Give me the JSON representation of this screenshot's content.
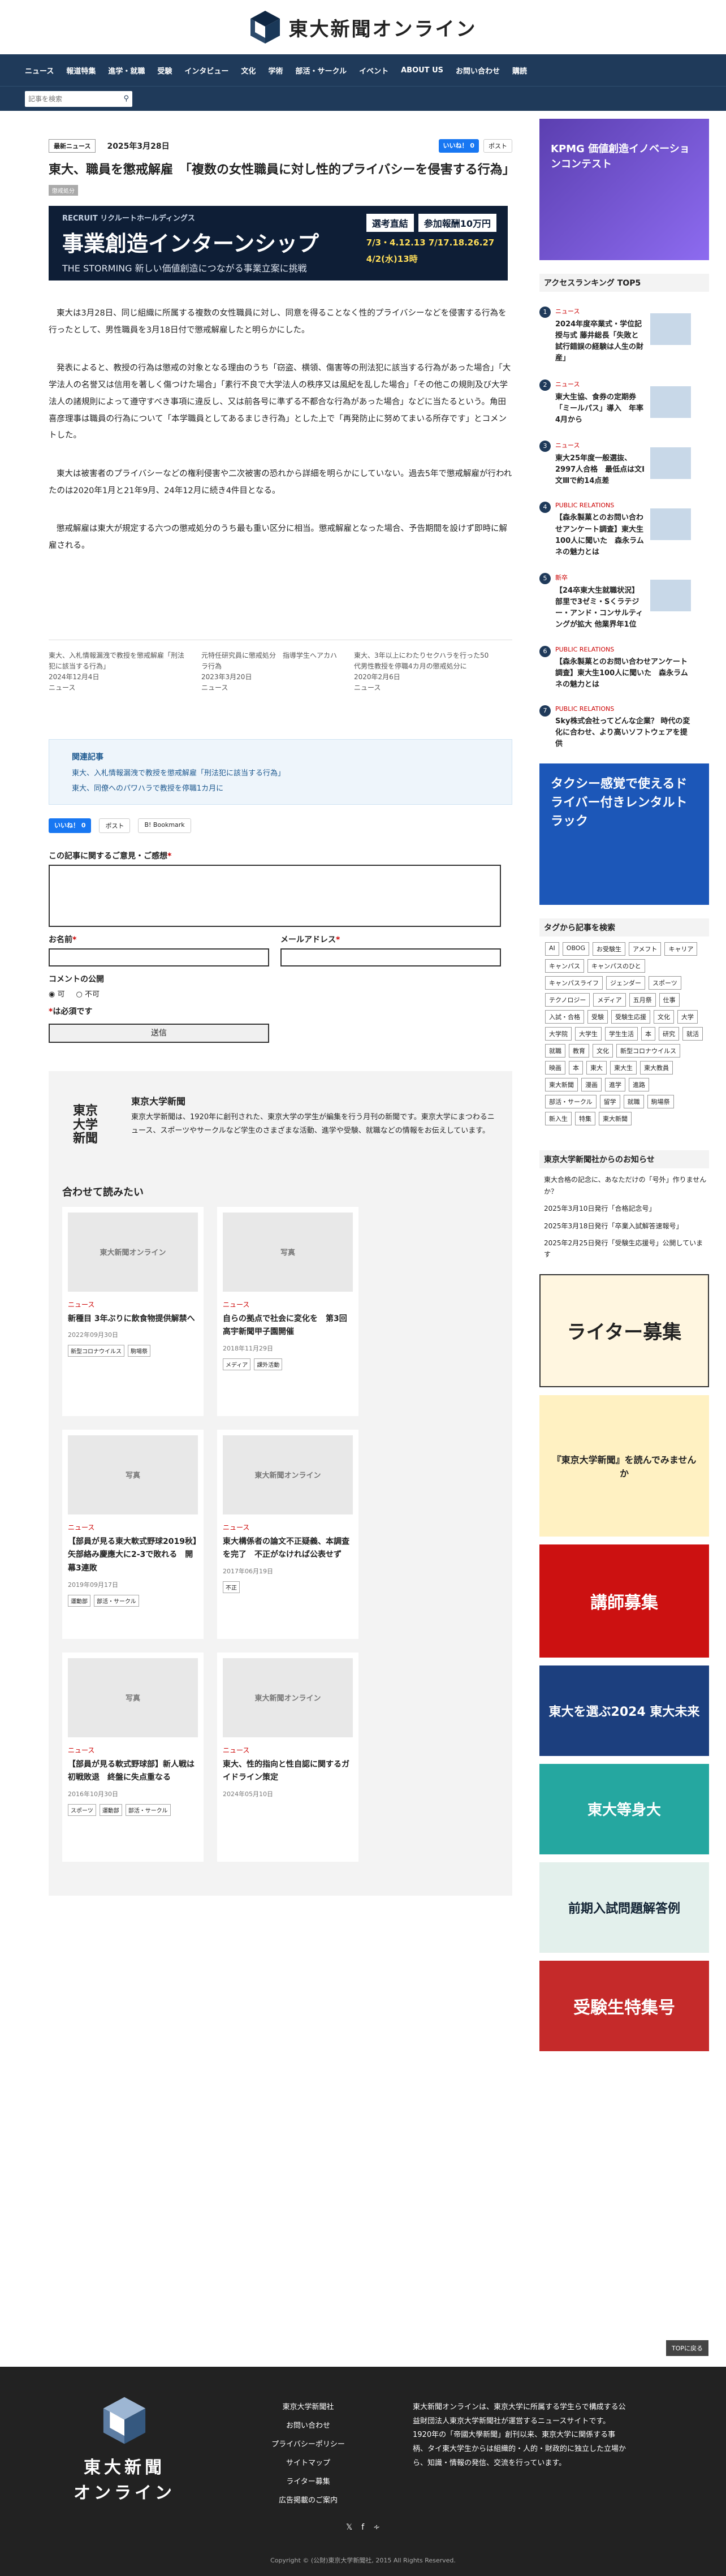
{
  "site_title": "東大新聞オンライン",
  "nav": [
    "ニュース",
    "報道特集",
    "進学・就職",
    "受験",
    "インタビュー",
    "文化",
    "学術",
    "部活・サークル",
    "イベント",
    "ABOUT US",
    "お問い合わせ",
    "購読"
  ],
  "search_placeholder": "記事を検索",
  "article": {
    "badge": "最新ニュース",
    "date": "2025年3月28日",
    "fb": "いいね！ 0",
    "tw": "ポスト",
    "title": "東大、職員を懲戒解雇　「複数の女性職員に対し性的プライバシーを侵害する行為」",
    "tag": "懲戒処分",
    "banner": {
      "brand": "RECRUIT リクルートホールディングス",
      "title": "事業創造インターンシップ",
      "sub": "THE STORMING 新しい価値創造につながる事業立案に挑戦",
      "pill1": "選考直結",
      "pill2": "参加報酬10万円",
      "dates": "7/3・4.12.13  7/17.18.26.27",
      "entry": "4/2(水)13時"
    },
    "paragraphs": [
      "東大は3月28日、同じ組織に所属する複数の女性職員に対し、同意を得ることなく性的プライバシーなどを侵害する行為を行ったとして、男性職員を3月18日付で懲戒解雇したと明らかにした。",
      "発表によると、教授の行為は懲戒の対象となる理由のうち「窃盗、横領、傷害等の刑法犯に該当する行為があった場合」「大学法人の名誉又は信用を著しく傷つけた場合」「素行不良で大学法人の秩序又は風紀を乱した場合」「その他この規則及び大学法人の諸規則によって遵守すべき事項に違反し、又は前各号に準ずる不都合な行為があった場合」などに当たるという。角田喜彦理事は職員の行為について「本学職員としてあるまじき行為」とした上で「再発防止に努めてまいる所存です」とコメントした。",
      "東大は被害者のプライバシーなどの権利侵害や二次被害の恐れから詳細を明らかにしていない。過去5年で懲戒解雇が行われたのは2020年1月と21年9月、24年12月に続き4件目となる。",
      "懲戒解雇は東大が規定する六つの懲戒処分のうち最も重い区分に相当。懲戒解雇となった場合、予告期間を設けず即時に解雇される。"
    ],
    "related": [
      {
        "t": "東大、入札情報漏洩で教授を懲戒解雇「刑法犯に該当する行為」",
        "d": "2024年12月4日",
        "c": "ニュース"
      },
      {
        "t": "元特任研究員に懲戒処分　指導学生へアカハラ行為",
        "d": "2023年3月20日",
        "c": "ニュース"
      },
      {
        "t": "東大、3年以上にわたりセクハラを行った50代男性教授を停職4カ月の懲戒処分に",
        "d": "2020年2月6日",
        "c": "ニュース"
      }
    ],
    "kanren_head": "関連記事",
    "kanren": [
      "東大、入札情報漏洩で教授を懲戒解雇「刑法犯に該当する行為」",
      "東大、同僚へのパワハラで教授を停職1カ月に"
    ],
    "share": [
      "いいね！ 0",
      "ポスト",
      "B! Bookmark"
    ]
  },
  "form": {
    "label1": "この記事に関するご意見・ご感想",
    "label2": "お名前",
    "label3": "メールアドレス",
    "label4": "コメントの公開",
    "opt1": "可",
    "opt2": "不可",
    "note": "は必須です",
    "submit": "送信"
  },
  "about": {
    "logo": "東京\n大学\n新聞",
    "title": "東京大学新聞",
    "desc": "東京大学新聞は、1920年に創刊された、東京大学の学生が編集を行う月刊の新聞です。東京大学にまつわるニュース、スポーツやサークルなど学生のさまざまな活動、進学や受験、就職などの情報をお伝えしています。"
  },
  "awase": "合わせて読みたい",
  "cards": [
    {
      "img": "東大新聞オンライン",
      "cat": "ニュース",
      "t": "新種目 3年ぶりに飲食物提供解禁へ",
      "d": "2022年09月30日",
      "tags": [
        "新型コロナウイルス",
        "駒場祭"
      ]
    },
    {
      "img": "写真",
      "cat": "ニュース",
      "t": "自らの拠点で社会に変化を　第3回高宇新聞甲子園開催",
      "d": "2018年11月29日",
      "tags": [
        "メディア",
        "課外活動"
      ]
    },
    {
      "img": "写真",
      "cat": "ニュース",
      "t": "【部員が見る東大軟式野球2019秋】矢部絡み慶應大に2-3で敗れる　開幕3連敗",
      "d": "2019年09月17日",
      "tags": [
        "運動部",
        "部活・サークル"
      ]
    },
    {
      "img": "東大新聞オンライン",
      "cat": "ニュース",
      "t": "東大構係者の論文不正疑義、本調査を完了　不正がなければ公表せず",
      "d": "2017年06月19日",
      "tags": [
        "不正"
      ]
    },
    {
      "img": "写真",
      "cat": "ニュース",
      "t": "【部員が見る軟式野球部】新人戦は初戦敗退　終盤に失点重なる",
      "d": "2016年10月30日",
      "tags": [
        "スポーツ",
        "運動部",
        "部活・サークル"
      ]
    },
    {
      "img": "東大新聞オンライン",
      "cat": "ニュース",
      "t": "東大、性的指向と性自認に関するガイドライン策定",
      "d": "2024年05月10日",
      "tags": []
    }
  ],
  "sidebar": {
    "ad_top": "KPMG 価値創造イノベーションコンテスト",
    "rank_head": "アクセスランキング TOP5",
    "ranks": [
      {
        "c": "ニュース",
        "t": "2024年度卒業式・学位記授与式 藤井総長「失敗と試行錯誤の経験は人生の財産」"
      },
      {
        "c": "ニュース",
        "t": "東大生協、食券の定期券「ミールパス」導入　年率4月から"
      },
      {
        "c": "ニュース",
        "t": "東大25年度一般選抜、2997人合格　最低点は文Ⅰ文Ⅲで約14点差"
      },
      {
        "c": "PUBLIC RELATIONS",
        "t": "【森永製菓とのお問い合わせアンケート調査】東大生100人に聞いた　森永ラムネの魅力とは"
      },
      {
        "c": "新卒",
        "t": "【24卒東大生就職状況】部里で3ゼミ・Sくラテジー・アンド・コンサルティングが拡大 他業界年1位"
      }
    ],
    "pr": [
      {
        "c": "PUBLIC RELATIONS",
        "t": "【森永製菓とのお問い合わせアンケート調査】東大生100人に聞いた　森永ラムネの魅力とは"
      },
      {
        "c": "PUBLIC RELATIONS",
        "t": "Sky株式会社ってどんな企業？ 時代の変化に合わせ、より高いソフトウェアを提供"
      }
    ],
    "taxi": "タクシー感覚で使えるドライバー付きレンタルトラック",
    "tag_head": "タグから記事を検索",
    "tags": [
      "AI",
      "OBOG",
      "お受験生",
      "アメフト",
      "キャリア",
      "キャンパス",
      "キャンパスのひと",
      "キャンパスライフ",
      "ジェンダー",
      "スポーツ",
      "テクノロジー",
      "メディア",
      "五月祭",
      "仕事",
      "入試・合格",
      "受験",
      "受験生応援",
      "文化",
      "大学",
      "大学院",
      "大学生",
      "学生生活",
      "本",
      "研究",
      "就活",
      "就職",
      "教育",
      "文化",
      "新型コロナウイルス",
      "映画",
      "本",
      "東大",
      "東大生",
      "東大教員",
      "東大新聞",
      "漫画",
      "進学",
      "進路",
      "部活・サークル",
      "留学",
      "就職",
      "駒場祭",
      "新入生",
      "特集",
      "東大新聞"
    ],
    "msg_head": "東京大学新聞社からのお知らせ",
    "msgs": [
      "東大合格の記念に、あなただけの「号外」作りませんか？",
      "2025年3月10日発行「合格記念号」",
      "2025年3月18日発行「卒業入試解答速報号」",
      "2025年2月25日発行「受験生応援号」公開しています"
    ],
    "ad1": "ライター募集",
    "ad2": "『東京大学新聞』を読んでみませんか",
    "ad3": "講師募集",
    "ad4": "東大を選ぶ2024 東大未来",
    "ad5": "東大等身大",
    "ad6": "前期入試問題解答例",
    "ad7": "受験生特集号"
  },
  "footer": {
    "logo": "東大新聞\nオンライン",
    "links": [
      "東京大学新聞社",
      "お問い合わせ",
      "プライバシーポリシー",
      "サイトマップ",
      "ライター募集",
      "広告掲載のご案内"
    ],
    "desc": "東大新聞オンラインは、東京大学に所属する学生らで構成する公益財団法人東京大学新聞社が運営するニュースサイトです。1920年の「帝國大學新聞」創刊以来、東京大学に関係する事柄、タイ東大学生からは組織的・人的・財政的に独立した立場から、知識・情報の発信、交流を行っています。",
    "copy": "Copyright © (公財)東京大学新聞社, 2015 All Rights Reserved.",
    "top": "TOPに戻る"
  }
}
